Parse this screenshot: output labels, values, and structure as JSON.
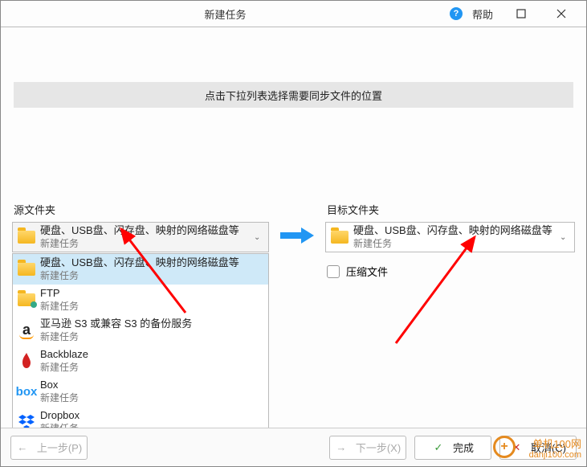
{
  "window": {
    "title": "新建任务",
    "help_label": "帮助"
  },
  "banner": "点击下拉列表选择需要同步文件的位置",
  "source": {
    "label": "源文件夹",
    "selected": {
      "title": "硬盘、USB盘、闪存盘、映射的网络磁盘等",
      "subtitle": "新建任务"
    },
    "options": [
      {
        "key": "local",
        "title": "硬盘、USB盘、闪存盘、映射的网络磁盘等",
        "subtitle": "新建任务",
        "icon": "folder"
      },
      {
        "key": "ftp",
        "title": "FTP",
        "subtitle": "新建任务",
        "icon": "folder-net"
      },
      {
        "key": "amazon",
        "title": "亚马逊 S3 或兼容 S3 的备份服务",
        "subtitle": "新建任务",
        "icon": "amazon"
      },
      {
        "key": "backblaze",
        "title": "Backblaze",
        "subtitle": "新建任务",
        "icon": "backblaze"
      },
      {
        "key": "box",
        "title": "Box",
        "subtitle": "新建任务",
        "icon": "box"
      },
      {
        "key": "dropbox",
        "title": "Dropbox",
        "subtitle": "新建任务",
        "icon": "dropbox"
      }
    ]
  },
  "target": {
    "label": "目标文件夹",
    "selected": {
      "title": "硬盘、USB盘、闪存盘、映射的网络磁盘等",
      "subtitle": "新建任务"
    },
    "compress_label": "压缩文件"
  },
  "footer": {
    "prev": "上一步(P)",
    "next": "下一步(X)",
    "finish": "完成",
    "cancel": "取消(C)"
  },
  "watermark": {
    "line1": "单机100网",
    "line2": "danji100.com"
  }
}
